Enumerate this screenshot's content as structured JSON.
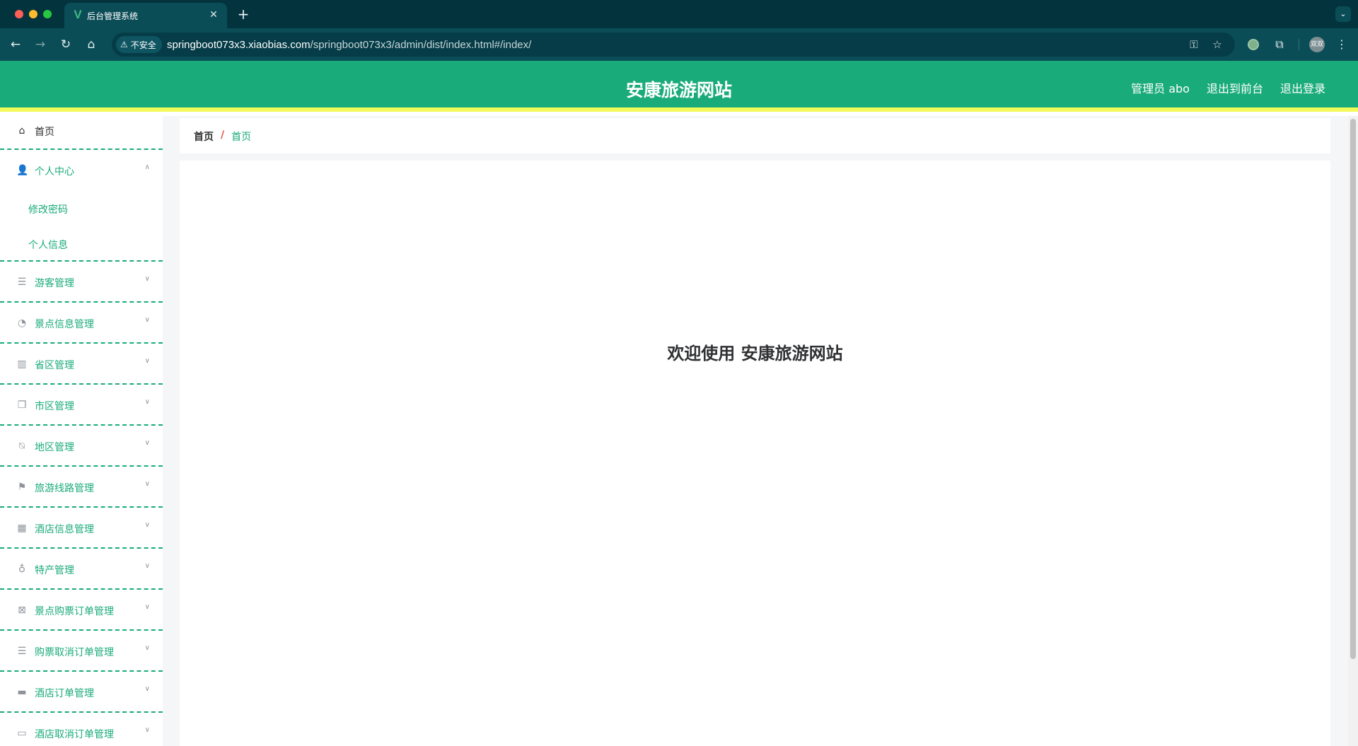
{
  "browser": {
    "tab_title": "后台管理系统",
    "tab_favicon": "V",
    "security_label": "不安全",
    "url_host": "springboot073x3.xiaobias.com",
    "url_path": "/springboot073x3/admin/dist/index.html#/index/",
    "profile_initials": "双双"
  },
  "header": {
    "site_title": "安康旅游网站",
    "admin_label": "管理员 abo",
    "to_front_label": "退出到前台",
    "logout_label": "退出登录"
  },
  "sidebar": {
    "home": {
      "label": "首页",
      "icon": "home-icon"
    },
    "personal": {
      "label": "个人中心",
      "icon": "user-icon",
      "children": [
        {
          "label": "修改密码"
        },
        {
          "label": "个人信息"
        }
      ]
    },
    "items": [
      {
        "label": "游客管理",
        "icon": "list-icon"
      },
      {
        "label": "景点信息管理",
        "icon": "dashboard-icon"
      },
      {
        "label": "省区管理",
        "icon": "library-icon"
      },
      {
        "label": "市区管理",
        "icon": "copy-icon"
      },
      {
        "label": "地区管理",
        "icon": "bell-off-icon"
      },
      {
        "label": "旅游线路管理",
        "icon": "flag-icon"
      },
      {
        "label": "酒店信息管理",
        "icon": "grid-icon"
      },
      {
        "label": "特产管理",
        "icon": "microphone-icon"
      },
      {
        "label": "景点购票订单管理",
        "icon": "delete-box-icon"
      },
      {
        "label": "购票取消订单管理",
        "icon": "list-icon"
      },
      {
        "label": "酒店订单管理",
        "icon": "monitor-icon"
      },
      {
        "label": "酒店取消订单管理",
        "icon": "printer-icon"
      }
    ]
  },
  "breadcrumb": {
    "root": "首页",
    "separator": "/",
    "current": "首页"
  },
  "main": {
    "welcome": "欢迎使用 安康旅游网站"
  },
  "colors": {
    "primary": "#1aab7a",
    "header_border": "#f3fb5a",
    "breadcrumb_separator": "#e74c3c"
  }
}
